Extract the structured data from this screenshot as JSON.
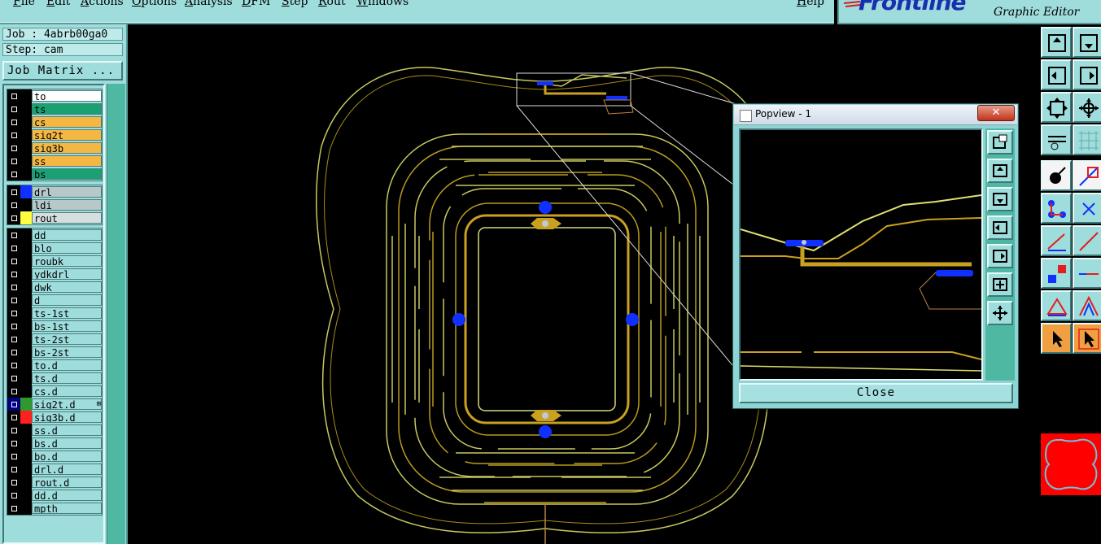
{
  "menu": {
    "items": [
      "File",
      "Edit",
      "Actions",
      "Options",
      "Analysis",
      "DFM",
      "Step",
      "Rout",
      "Windows"
    ],
    "help": "Help"
  },
  "brand": {
    "logo": "Frontline",
    "subtitle": "Graphic Editor"
  },
  "job": {
    "job_label": "Job : 4abrb00ga0",
    "step_label": "Step: cam",
    "matrix_button": "Job Matrix ..."
  },
  "layers": {
    "group1": [
      {
        "name": "to",
        "color": "#ffffff"
      },
      {
        "name": "ts",
        "color": "#1aa071"
      },
      {
        "name": "cs",
        "color": "#f5b744"
      },
      {
        "name": "sig2t",
        "color": "#f5b744"
      },
      {
        "name": "sig3b",
        "color": "#f5b744"
      },
      {
        "name": "ss",
        "color": "#f5b744"
      },
      {
        "name": "bs",
        "color": "#1aa071"
      }
    ],
    "group2": [
      {
        "name": "drl",
        "color": "#b8c8c8",
        "swatch": "#1030ff"
      },
      {
        "name": "ldi",
        "color": "#b8c8c8",
        "swatch": "#000000"
      },
      {
        "name": "rout",
        "color": "#d6dede",
        "swatch": "#ffff40"
      }
    ],
    "group3": [
      {
        "name": "dd"
      },
      {
        "name": "blo"
      },
      {
        "name": "roubk"
      },
      {
        "name": "ydkdrl"
      },
      {
        "name": "dwk"
      },
      {
        "name": "d"
      },
      {
        "name": "ts-1st"
      },
      {
        "name": "bs-1st"
      },
      {
        "name": "ts-2st"
      },
      {
        "name": "bs-2st"
      },
      {
        "name": "to.d"
      },
      {
        "name": "ts.d"
      },
      {
        "name": "cs.d"
      },
      {
        "name": "sig2t.d",
        "swatch": "#2e9a2e",
        "checked": true,
        "mark": "⊞"
      },
      {
        "name": "sig3b.d",
        "swatch": "#ff2020"
      },
      {
        "name": "ss.d"
      },
      {
        "name": "bs.d"
      },
      {
        "name": "bo.d"
      },
      {
        "name": "drl.d"
      },
      {
        "name": "rout.d"
      },
      {
        "name": "dd.d"
      },
      {
        "name": "mpth"
      }
    ]
  },
  "popview": {
    "title": "Popview - 1",
    "close_x": "✕",
    "close_button": "Close"
  },
  "colors": {
    "panel": "#9fdcdc",
    "accent_teal": "#4fb8a2",
    "trace": "#c9a020",
    "outline": "#c8c860",
    "pad": "#1030ff"
  }
}
